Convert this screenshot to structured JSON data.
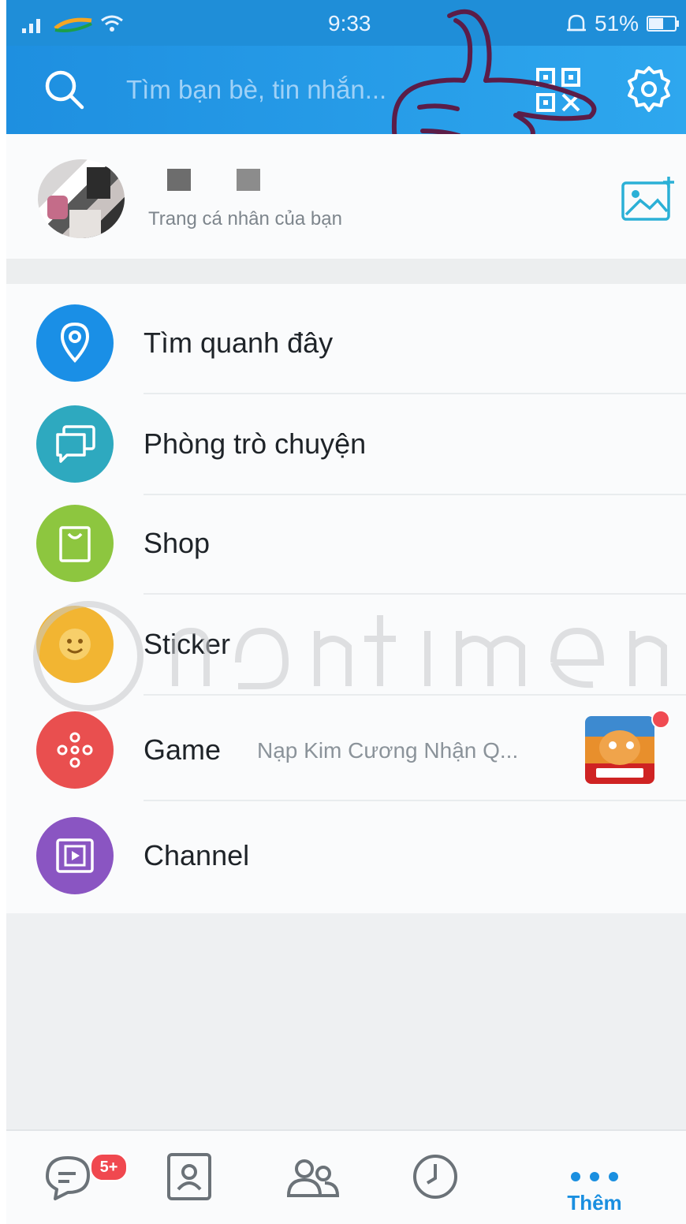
{
  "status_bar": {
    "time": "9:33",
    "battery_percent": "51%",
    "icons": [
      "signal-icon",
      "carrier-icon",
      "wifi-icon",
      "alarm-icon",
      "battery-icon"
    ]
  },
  "header": {
    "search_placeholder": "Tìm bạn bè, tin nhắn...",
    "icons": [
      "search-icon",
      "qr-icon",
      "gear-icon"
    ],
    "accent_color": "#2196e8"
  },
  "profile": {
    "subtitle": "Trang cá nhân của bạn"
  },
  "menu": {
    "items": [
      {
        "label": "Tìm quanh đây",
        "icon": "location-pin-icon",
        "color": "#1a8fe6"
      },
      {
        "label": "Phòng trò chuyện",
        "icon": "chat-rooms-icon",
        "color": "#2ea9bf"
      },
      {
        "label": "Shop",
        "icon": "shopping-bag-icon",
        "color": "#8dc63f"
      },
      {
        "label": "Sticker",
        "icon": "sticker-icon",
        "color": "#f2b532"
      },
      {
        "label": "Game",
        "icon": "gamepad-icon",
        "color": "#e94f4f",
        "subtitle": "Nạp Kim Cương Nhận Q..."
      },
      {
        "label": "Channel",
        "icon": "channel-icon",
        "color": "#8a55c2"
      }
    ]
  },
  "bottom_nav": {
    "messages_badge": "5+",
    "more_label": "Thêm",
    "icons": [
      "messages-icon",
      "contacts-icon",
      "groups-icon",
      "timeline-clock-icon",
      "more-dots-icon"
    ]
  }
}
